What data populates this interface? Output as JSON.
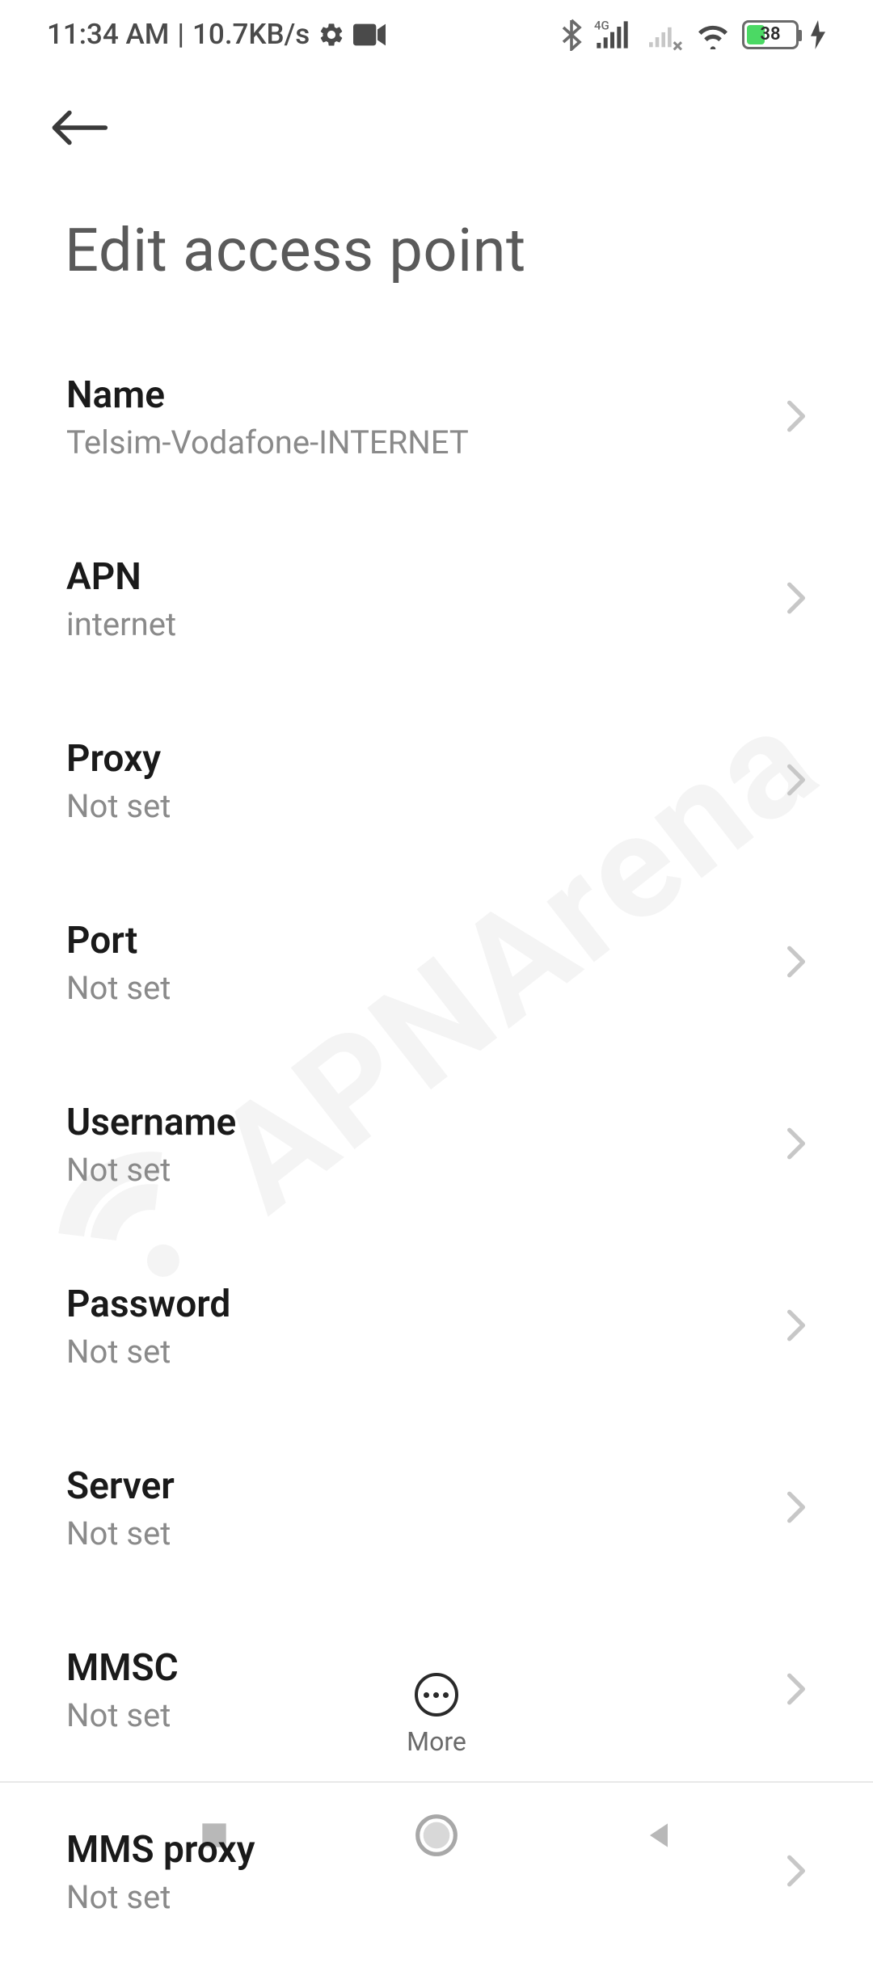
{
  "status": {
    "time": "11:34 AM",
    "speed": "10.7KB/s",
    "battery": "38"
  },
  "header": {
    "title": "Edit access point"
  },
  "fields": [
    {
      "label": "Name",
      "value": "Telsim-Vodafone-INTERNET"
    },
    {
      "label": "APN",
      "value": "internet"
    },
    {
      "label": "Proxy",
      "value": "Not set"
    },
    {
      "label": "Port",
      "value": "Not set"
    },
    {
      "label": "Username",
      "value": "Not set"
    },
    {
      "label": "Password",
      "value": "Not set"
    },
    {
      "label": "Server",
      "value": "Not set"
    },
    {
      "label": "MMSC",
      "value": "Not set"
    },
    {
      "label": "MMS proxy",
      "value": "Not set"
    }
  ],
  "bottom": {
    "more": "More"
  },
  "watermark": "APNArena"
}
